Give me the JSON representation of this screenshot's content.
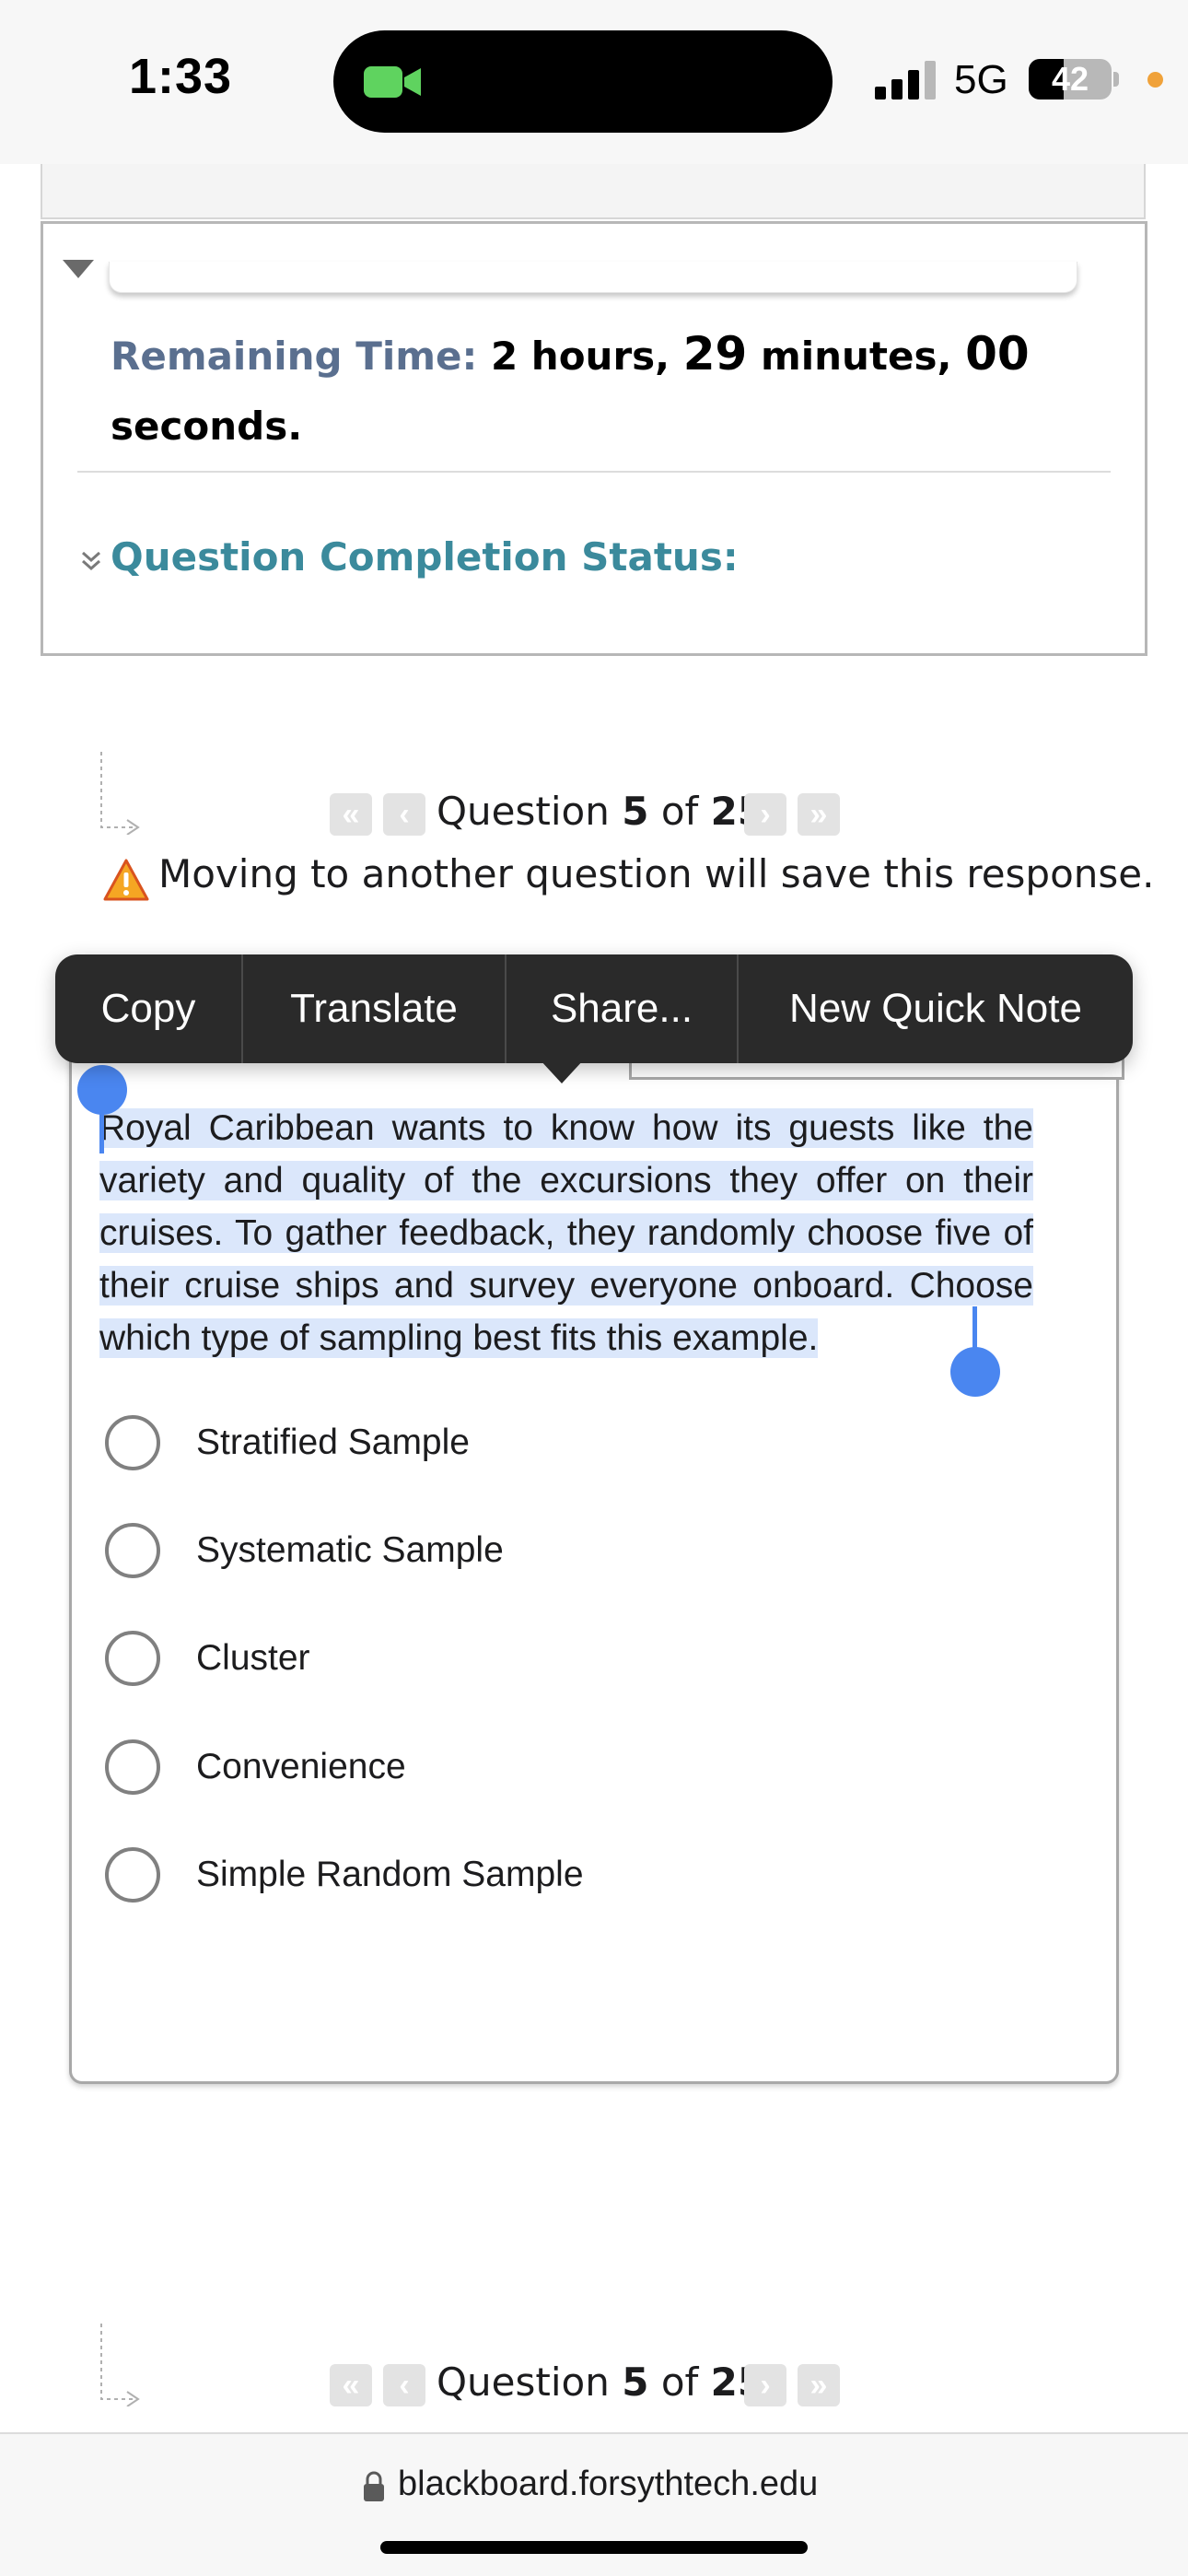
{
  "status_bar": {
    "time": "1:33",
    "network": "5G",
    "battery_level": "42",
    "battery_fraction": 0.42,
    "icons": [
      "facetime-camera-icon",
      "cellular-signal-icon",
      "battery-icon",
      "orange-privacy-dot"
    ]
  },
  "timer": {
    "label": "Remaining Time:",
    "hours": "2",
    "hours_unit": "hours,",
    "minutes": "29",
    "minutes_unit": "minutes,",
    "seconds": "00",
    "seconds_unit": "seconds."
  },
  "completion_status": {
    "label": "Question Completion Status:"
  },
  "question_nav": {
    "prefix": "Question",
    "current": "5",
    "separator": "of",
    "total": "25",
    "first_icon": "«",
    "prev_icon": "‹",
    "next_icon": "›",
    "last_icon": "»"
  },
  "warning": {
    "text": "Moving to another question will save this response."
  },
  "context_menu": {
    "items": [
      "Copy",
      "Translate",
      "Share...",
      "New Quick Note"
    ]
  },
  "question": {
    "text": "Royal Caribbean wants to know how its guests like the variety and quality of the excursions they offer on their cruises. To gather feedback, they randomly choose five of their cruise ships and survey everyone onboard. Choose which type of sampling best fits this example.",
    "options": [
      "Stratified Sample",
      "Systematic Sample",
      "Cluster",
      "Convenience",
      "Simple Random Sample"
    ]
  },
  "browser": {
    "url": "blackboard.forsythtech.edu"
  },
  "colors": {
    "timer_label": "#5a6f8f",
    "completion_label": "#3b8a9c",
    "selection_highlight": "#dbe7fb",
    "selection_handle": "#4a86f0",
    "context_menu_bg": "#2a2a2a"
  }
}
